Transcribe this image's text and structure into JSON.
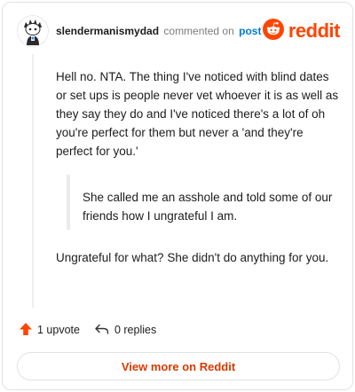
{
  "comment": {
    "username": "slendermanismydad",
    "action": "commented on",
    "post_link": "post",
    "paragraph1": "Hell no. NTA. The thing I've noticed with blind dates or set ups is people never vet whoever it is as well as they say they do and I've noticed there's a lot of oh you're perfect for them but never a 'and they're perfect for you.'",
    "quote": "She called me an asshole and told some of our friends how I ungrateful I am.",
    "paragraph2": "Ungrateful for what? She didn't do anything for you."
  },
  "brand": {
    "name": "reddit",
    "color": "#ff4500"
  },
  "actions": {
    "upvote_label": "1 upvote",
    "replies_label": "0 replies"
  },
  "footer": {
    "view_more_label": "View more on Reddit"
  },
  "colors": {
    "accent": "#ff4500",
    "link": "#0079d3",
    "view_more": "#d93a00"
  },
  "icons": {
    "avatar": "snoo-avatar-icon",
    "logo": "reddit-logo-icon",
    "upvote": "upvote-arrow-icon",
    "reply": "reply-arrow-icon"
  }
}
